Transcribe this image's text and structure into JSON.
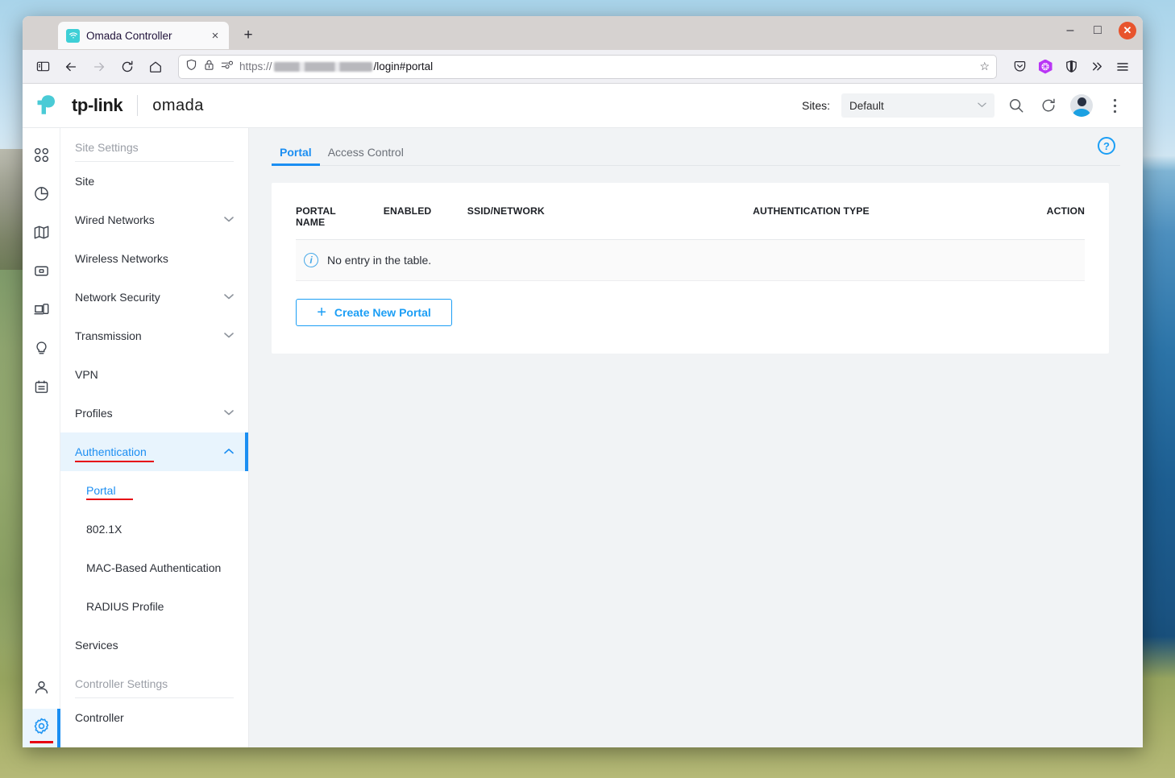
{
  "browser": {
    "tab": {
      "title": "Omada Controller",
      "favicon": "wifi-icon",
      "close": "×"
    },
    "new_tab_label": "+",
    "window_controls": {
      "minimize": "–",
      "maximize": "□",
      "close": "✕"
    },
    "nav": {
      "sidebar_toggle": "sidebar-icon",
      "back": "←",
      "forward": "→",
      "reload": "↻",
      "home": "home-icon"
    },
    "url": {
      "scheme": "https://",
      "host_redacted": "",
      "path": "/login#portal",
      "shield": "shield-icon",
      "lock_warning": "lock-warning-icon",
      "permissions": "permissions-icon",
      "bookmark": "☆"
    },
    "toolbar_icons": [
      "pocket-icon",
      "extension-icon",
      "container-icon",
      "overflow-icon",
      "menu-icon"
    ]
  },
  "app": {
    "brand": {
      "tp_link": "tp-link",
      "omada": "omada"
    },
    "header": {
      "sites_label": "Sites:",
      "site_selected": "Default",
      "site_caret": "⌄",
      "search_icon": "search-icon",
      "refresh_icon": "refresh-icon",
      "avatar": "avatar-icon",
      "more_icon": "kebab-menu-icon"
    },
    "rail": [
      {
        "name": "dashboard",
        "icon": "dashboard-icon"
      },
      {
        "name": "statistics",
        "icon": "pie-chart-icon"
      },
      {
        "name": "map",
        "icon": "map-icon"
      },
      {
        "name": "devices",
        "icon": "device-icon"
      },
      {
        "name": "clients",
        "icon": "clients-icon"
      },
      {
        "name": "insight",
        "icon": "lightbulb-icon"
      },
      {
        "name": "log",
        "icon": "log-icon"
      }
    ],
    "rail_bottom": [
      {
        "name": "account",
        "icon": "person-icon",
        "active": false
      },
      {
        "name": "settings",
        "icon": "gear-icon",
        "active": true
      }
    ],
    "sidebar": {
      "group_site_settings": "Site Settings",
      "items": [
        {
          "label": "Site",
          "expandable": false
        },
        {
          "label": "Wired Networks",
          "expandable": true
        },
        {
          "label": "Wireless Networks",
          "expandable": false
        },
        {
          "label": "Network Security",
          "expandable": true
        },
        {
          "label": "Transmission",
          "expandable": true
        },
        {
          "label": "VPN",
          "expandable": false
        },
        {
          "label": "Profiles",
          "expandable": true
        },
        {
          "label": "Authentication",
          "expandable": true
        }
      ],
      "authentication_label": "Authentication",
      "submenu": [
        {
          "label": "Portal",
          "active": true
        },
        {
          "label": "802.1X",
          "active": false
        },
        {
          "label": "MAC-Based Authentication",
          "active": false
        },
        {
          "label": "RADIUS Profile",
          "active": false
        }
      ],
      "services_label": "Services",
      "group_controller_settings": "Controller Settings",
      "controller_label": "Controller",
      "chevron_down": "⌄",
      "chevron_up": "⌃"
    },
    "main": {
      "tabs": [
        {
          "label": "Portal",
          "active": true
        },
        {
          "label": "Access Control",
          "active": false
        }
      ],
      "help_icon": "help-icon",
      "help_glyph": "?",
      "table": {
        "columns": [
          "PORTAL NAME",
          "ENABLED",
          "SSID/NETWORK",
          "AUTHENTICATION TYPE",
          "ACTION"
        ],
        "portal_name_line1": "PORTAL",
        "portal_name_line2": "NAME",
        "empty_message": "No entry in the table.",
        "empty_icon": "info-icon",
        "rows": []
      },
      "create_button": {
        "label": "Create New Portal",
        "icon": "plus-icon",
        "glyph": "+"
      }
    }
  },
  "colors": {
    "accent_blue": "#1b8ef2",
    "brand_cyan": "#4ACBD6",
    "alert_red": "#e60012",
    "content_bg": "#f1f3f5"
  }
}
